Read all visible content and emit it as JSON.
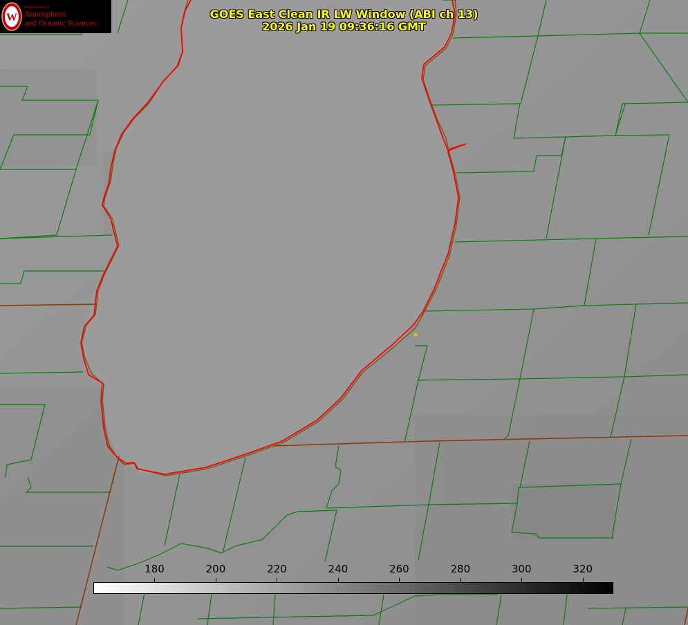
{
  "title": {
    "line1": "GOES East Clean IR LW Window (ABI ch 13)",
    "line2": "2026 Jan 19 09:36:16 GMT"
  },
  "logo": {
    "dept": "Department of",
    "line1": "Atmospheric",
    "line2": "and Oceanic Sciences"
  },
  "colorbar": {
    "min": 160,
    "max": 330,
    "ticks": [
      "180",
      "200",
      "220",
      "240",
      "260",
      "280",
      "300",
      "320"
    ],
    "tick_values": [
      180,
      200,
      220,
      240,
      260,
      280,
      300,
      320
    ],
    "color_low": "#ffffff",
    "color_high": "#000000"
  },
  "colors": {
    "background": "#959595",
    "county_lines": "#0b7d0b",
    "state_line": "#8b3a0a",
    "coastline": "#ff0000",
    "title": "#ffff00",
    "logo_red": "#c5050c",
    "marker": "#d4c800"
  }
}
